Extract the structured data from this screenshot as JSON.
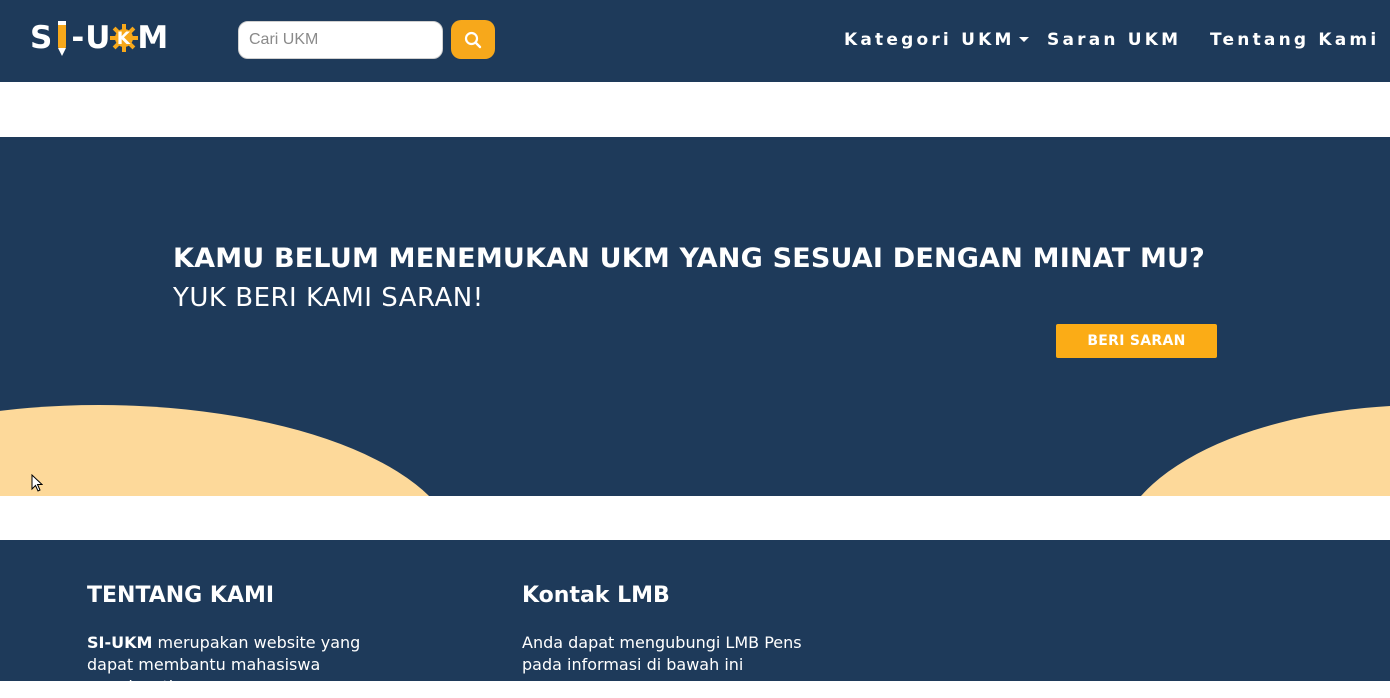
{
  "brand": {
    "logo_text": "SI-UKM"
  },
  "colors": {
    "navy": "#1e3a5a",
    "accent": "#fbac16",
    "blob": "#fdd99a"
  },
  "navbar": {
    "search_placeholder": "Cari UKM",
    "search_value": "",
    "search_icon": "search-icon",
    "links": [
      {
        "label": "Kategori UKM",
        "has_dropdown": true
      },
      {
        "label": "Saran UKM"
      },
      {
        "label": "Tentang Kami"
      }
    ]
  },
  "cta": {
    "headline": "KAMU BELUM MENEMUKAN UKM YANG SESUAI DENGAN MINAT MU?",
    "subline": "YUK BERI KAMI SARAN!",
    "button_label": "BERI SARAN"
  },
  "footer": {
    "about": {
      "heading": "TENTANG KAMI",
      "brand_bold": "SI-UKM",
      "text": " merupakan website yang dapat membantu mahasiswa mendapatkan"
    },
    "contact": {
      "heading": "Kontak LMB",
      "text": "Anda dapat mengubungi LMB Pens pada informasi di bawah ini"
    }
  }
}
